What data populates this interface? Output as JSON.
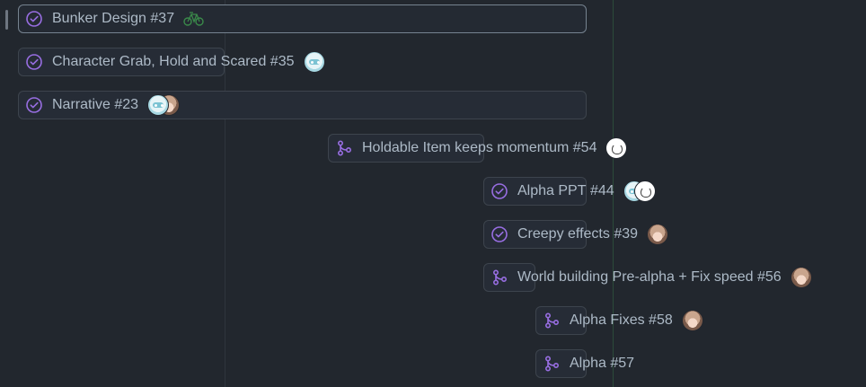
{
  "roadmap": {
    "items": [
      {
        "title": "Bunker Design",
        "number": "#37",
        "status": "closed-issue",
        "assignees": [
          "bike-icon"
        ],
        "selected": true
      },
      {
        "title": "Character Grab, Hold and Scared",
        "number": "#35",
        "status": "closed-issue",
        "assignees": [
          "bot-avatar"
        ]
      },
      {
        "title": "Narrative",
        "number": "#23",
        "status": "closed-issue",
        "assignees": [
          "bot-avatar",
          "girl-avatar"
        ]
      },
      {
        "title": "Holdable Item keeps momentum",
        "number": "#54",
        "status": "merged-pull-request",
        "assignees": [
          "cat-avatar"
        ]
      },
      {
        "title": "Alpha PPT",
        "number": "#44",
        "status": "closed-issue",
        "assignees": [
          "bot-avatar",
          "cat-avatar"
        ]
      },
      {
        "title": "Creepy effects",
        "number": "#39",
        "status": "closed-issue",
        "assignees": [
          "girl-avatar"
        ]
      },
      {
        "title": "World building Pre-alpha + Fix speed",
        "number": "#56",
        "status": "merged-pull-request",
        "assignees": [
          "girl-avatar"
        ]
      },
      {
        "title": "Alpha Fixes",
        "number": "#58",
        "status": "merged-pull-request",
        "assignees": [
          "girl-avatar"
        ]
      },
      {
        "title": "Alpha",
        "number": "#57",
        "status": "merged-pull-request",
        "assignees": []
      }
    ]
  },
  "colors": {
    "background": "#22272e",
    "status_purple": "#986ee2",
    "text": "#adbac7",
    "bar_border": "#3d444d",
    "today_line": "#2c4a3a"
  }
}
